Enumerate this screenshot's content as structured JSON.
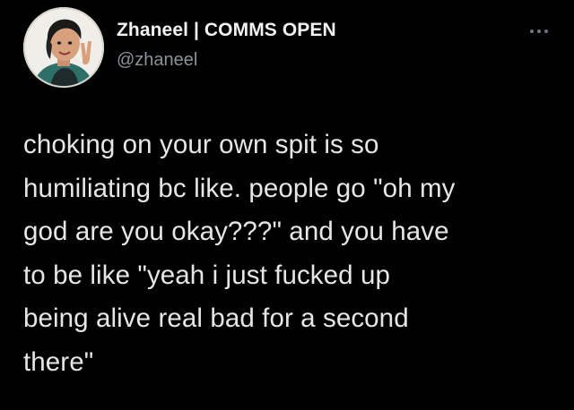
{
  "tweet": {
    "author": {
      "display_name": "Zhaneel | COMMS OPEN",
      "handle": "@zhaneel",
      "avatar_icon": "avatar-illustration"
    },
    "menu_icon": "more-options-icon",
    "text": "choking on your own spit is so\nhumiliating bc like. people go \"oh my\ngod are you okay???\" and you have\nto be like \"yeah i just fucked up\nbeing alive real bad for a second\nthere\""
  },
  "colors": {
    "background": "#000000",
    "text_primary": "#e7e9ea",
    "text_secondary": "#8b9299"
  }
}
